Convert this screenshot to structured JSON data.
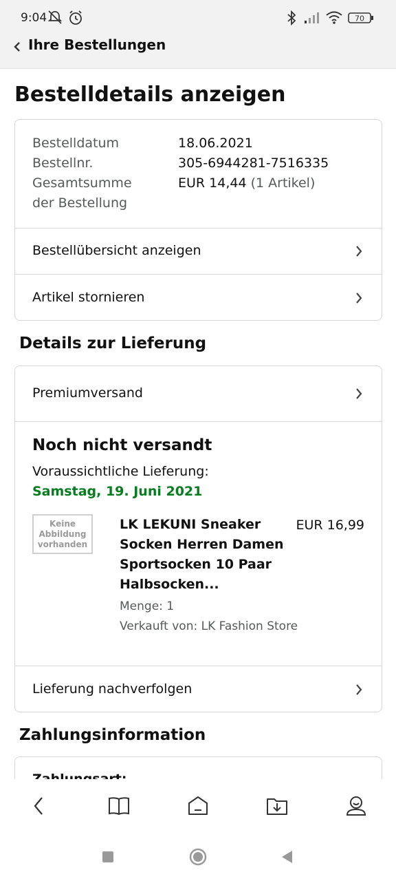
{
  "status_bar": {
    "time": "9:04",
    "battery": "70",
    "icons": [
      "mute-icon",
      "alarm-icon",
      "bluetooth-icon",
      "signal-icon",
      "wifi-icon",
      "battery-icon"
    ]
  },
  "header": {
    "back_icon": "chevron-left-icon",
    "title": "Ihre Bestellungen"
  },
  "page": {
    "title": "Bestelldetails anzeigen"
  },
  "order_summary": {
    "date_label": "Bestelldatum",
    "date_value": "18.06.2021",
    "number_label": "Bestellnr.",
    "number_value": "305-6944281-7516335",
    "total_label_line1": "Gesamtsumme",
    "total_label_line2": "der Bestellung",
    "total_value": "EUR 14,44",
    "total_count": "(1 Artikel)",
    "rows": [
      {
        "label": "Bestellübersicht anzeigen"
      },
      {
        "label": "Artikel stornieren"
      }
    ]
  },
  "delivery": {
    "section_title": "Details zur Lieferung",
    "shipping_method": "Premiumversand",
    "status": "Noch nicht versandt",
    "expected_label": "Voraussichtliche Lieferung:",
    "expected_date": "Samstag, 19. Juni 2021",
    "item": {
      "image_placeholder": [
        "Keine",
        "Abbildung",
        "vorhanden"
      ],
      "title_lines": [
        "LK LEKUNI Sneaker",
        "Socken Herren Damen",
        "Sportsocken 10 Paar",
        "Halbsocken..."
      ],
      "price": "EUR 16,99",
      "quantity": "Menge: 1",
      "seller": "Verkauft von: LK Fashion Store"
    },
    "track_label": "Lieferung nachverfolgen"
  },
  "payment": {
    "section_title": "Zahlungsinformation",
    "first_row_label": "Zahlungsart:"
  },
  "bottom_nav": {
    "items": [
      "back-icon",
      "book-icon",
      "home-icon",
      "download-folder-icon",
      "account-icon"
    ]
  },
  "system_nav": {
    "items": [
      "recents-icon",
      "home-circle-icon",
      "back-triangle-icon"
    ]
  },
  "colors": {
    "accent_green": "#067d1e",
    "border": "#d5d9d9",
    "header_bg": "#f2f2f2",
    "muted_text": "#565959"
  }
}
